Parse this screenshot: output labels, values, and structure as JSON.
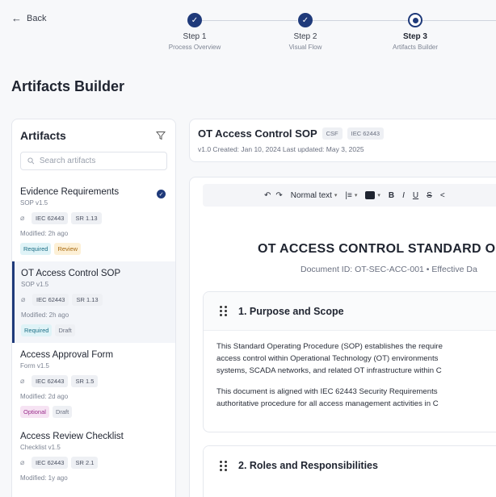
{
  "nav": {
    "back_label": "Back"
  },
  "stepper": {
    "steps": [
      {
        "title": "Step 1",
        "subtitle": "Process Overview",
        "state": "done"
      },
      {
        "title": "Step 2",
        "subtitle": "Visual Flow",
        "state": "done"
      },
      {
        "title": "Step 3",
        "subtitle": "Artifacts Builder",
        "state": "current"
      }
    ]
  },
  "page_title": "Artifacts Builder",
  "sidebar": {
    "title": "Artifacts",
    "search_placeholder": "Search artifacts",
    "items": [
      {
        "name": "Evidence Requirements",
        "meta": "SOP  v1.5",
        "tags": [
          "IEC 62443",
          "SR 1.13"
        ],
        "modified": "Modified: 2h ago",
        "badges": [
          "Required",
          "Review"
        ],
        "checked": true
      },
      {
        "name": "OT Access Control SOP",
        "meta": "SOP  v1.5",
        "tags": [
          "IEC 62443",
          "SR 1.13"
        ],
        "modified": "Modified: 2h ago",
        "badges": [
          "Required",
          "Draft"
        ],
        "selected": true
      },
      {
        "name": "Access Approval Form",
        "meta": "Form  v1.5",
        "tags": [
          "IEC 62443",
          "SR 1.5"
        ],
        "modified": "Modified: 2d ago",
        "badges": [
          "Optional",
          "Draft"
        ]
      },
      {
        "name": "Access Review Checklist",
        "meta": "Checklist  v1.5",
        "tags": [
          "IEC 62443",
          "SR 2.1"
        ],
        "modified": "Modified: 1y ago",
        "badges": []
      }
    ]
  },
  "document": {
    "title": "OT Access Control SOP",
    "tags": [
      "CSF",
      "IEC 62443"
    ],
    "meta": "v1.0  Created: Jan 10, 2024   Last updated: May 3, 2025"
  },
  "toolbar": {
    "undo": "↶",
    "redo": "↷",
    "text_style": "Normal text",
    "line_spacing": "|≡",
    "bold": "B",
    "italic": "I",
    "underline": "U",
    "strike": "S",
    "more": "<"
  },
  "editor": {
    "heading": "OT ACCESS CONTROL STANDARD OP",
    "doc_id": "Document ID: OT-SEC-ACC-001 • Effective Da",
    "sections": [
      {
        "title": "1. Purpose and Scope",
        "paragraphs": [
          [
            "This Standard Operating Procedure (SOP) establishes the require",
            "access control within Operational Technology (OT) environments",
            "systems, SCADA networks, and related OT infrastructure within C"
          ],
          [
            "This document is aligned with IEC 62443 Security Requirements",
            "authoritative procedure for all access management activities in C"
          ]
        ]
      },
      {
        "title": "2. Roles and Responsibilities",
        "paragraphs": []
      }
    ]
  },
  "colors": {
    "accent": "#1f3a7a",
    "required": "#1d6f86",
    "review": "#a86a10",
    "optional": "#9b2f8c"
  }
}
